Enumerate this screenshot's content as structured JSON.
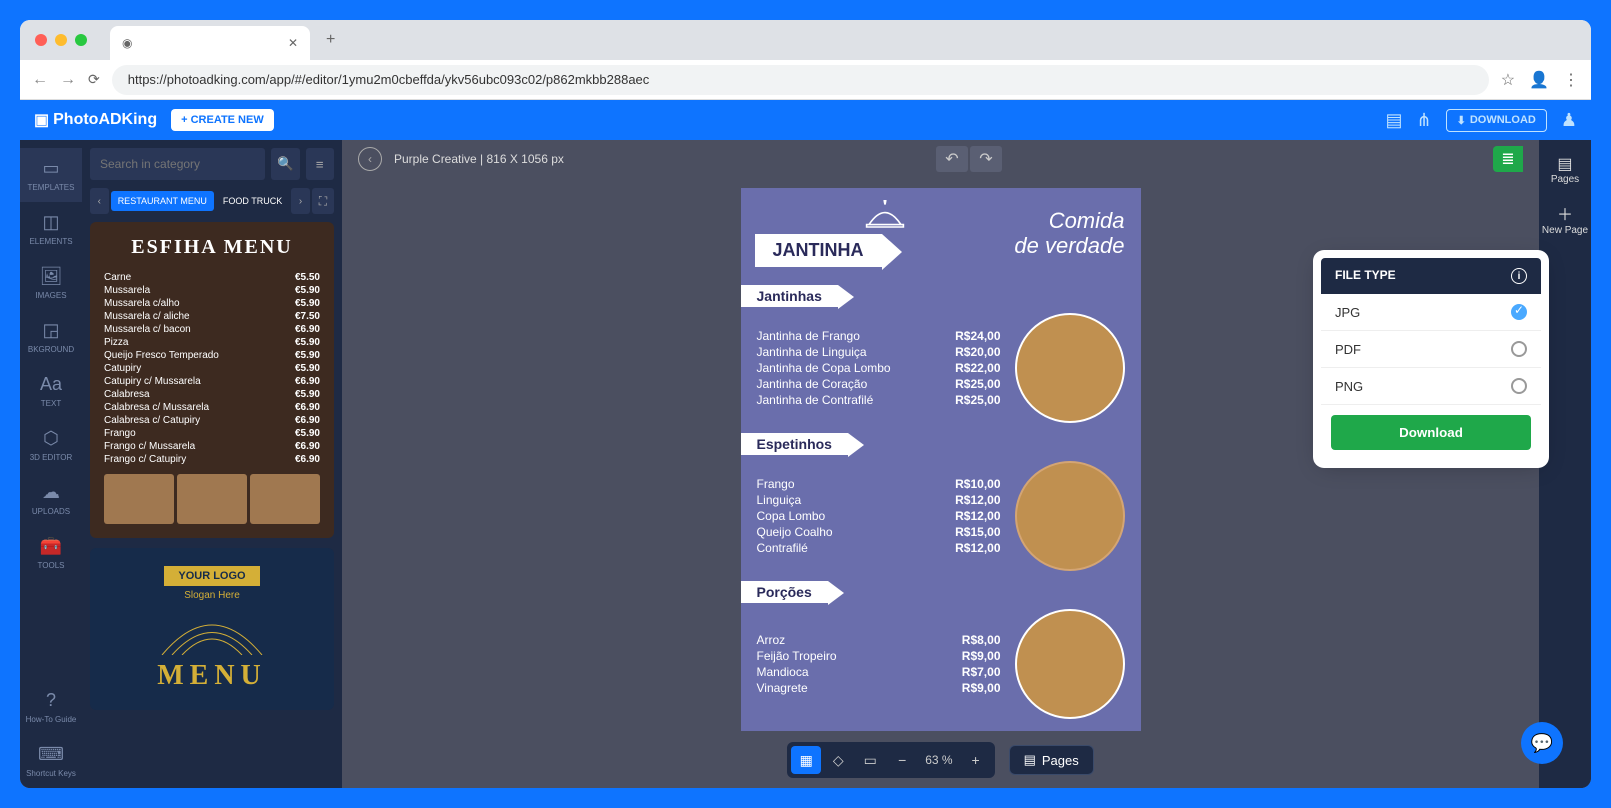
{
  "browser": {
    "url": "https://photoadking.com/app/#/editor/1ymu2m0cbeffda/ykv56ubc093c02/p862mkbb288aec"
  },
  "header": {
    "logo": "PhotoADKing",
    "create": "+ CREATE NEW",
    "download": "DOWNLOAD"
  },
  "leftIcons": {
    "templates": "TEMPLATES",
    "elements": "ELEMENTS",
    "images": "IMAGES",
    "bkground": "BKGROUND",
    "text": "TEXT",
    "threed": "3D EDITOR",
    "uploads": "UPLOADS",
    "tools": "TOOLS",
    "howto": "How-To Guide",
    "shortcuts": "Shortcut Keys"
  },
  "panel": {
    "search_ph": "Search in category",
    "cat1": "RESTAURANT MENU",
    "cat2": "FOOD TRUCK"
  },
  "tmpl1": {
    "title": "ESFIHA MENU",
    "rows": [
      {
        "n": "Carne",
        "p": "€5.50"
      },
      {
        "n": "Mussarela",
        "p": "€5.90"
      },
      {
        "n": "Mussarela c/alho",
        "p": "€5.90"
      },
      {
        "n": "Mussarela c/ aliche",
        "p": "€7.50"
      },
      {
        "n": "Mussarela c/ bacon",
        "p": "€6.90"
      },
      {
        "n": "Pizza",
        "p": "€5.90"
      },
      {
        "n": "Queijo Fresco Temperado",
        "p": "€5.90"
      },
      {
        "n": "Catupiry",
        "p": "€5.90"
      },
      {
        "n": "Catupiry c/ Mussarela",
        "p": "€6.90"
      },
      {
        "n": "Calabresa",
        "p": "€5.90"
      },
      {
        "n": "Calabresa c/ Mussarela",
        "p": "€6.90"
      },
      {
        "n": "Calabresa c/ Catupiry",
        "p": "€6.90"
      },
      {
        "n": "Frango",
        "p": "€5.90"
      },
      {
        "n": "Frango c/ Mussarela",
        "p": "€6.90"
      },
      {
        "n": "Frango c/ Catupiry",
        "p": "€6.90"
      }
    ]
  },
  "tmpl2": {
    "badge": "YOUR LOGO",
    "slogan": "Slogan Here",
    "title": "MENU"
  },
  "doc": {
    "name": "Purple Creative | 816 X 1056 px",
    "jantinha": "JANTINHA",
    "tagline1": "Comida",
    "tagline2": "de verdade",
    "sec1": "Jantinhas",
    "sec1items": [
      {
        "n": "Jantinha de Frango",
        "p": "R$24,00"
      },
      {
        "n": "Jantinha de Linguiça",
        "p": "R$20,00"
      },
      {
        "n": "Jantinha de Copa Lombo",
        "p": "R$22,00"
      },
      {
        "n": "Jantinha de Coração",
        "p": "R$25,00"
      },
      {
        "n": "Jantinha de Contrafilé",
        "p": "R$25,00"
      }
    ],
    "sec2": "Espetinhos",
    "sec2items": [
      {
        "n": "Frango",
        "p": "R$10,00"
      },
      {
        "n": "Linguiça",
        "p": "R$12,00"
      },
      {
        "n": "Copa Lombo",
        "p": "R$12,00"
      },
      {
        "n": "Queijo Coalho",
        "p": "R$15,00"
      },
      {
        "n": "Contrafilé",
        "p": "R$12,00"
      }
    ],
    "sec3": "Porções",
    "sec3items": [
      {
        "n": "Arroz",
        "p": "R$8,00"
      },
      {
        "n": "Feijão Tropeiro",
        "p": "R$9,00"
      },
      {
        "n": "Mandioca",
        "p": "R$7,00"
      },
      {
        "n": "Vinagrete",
        "p": "R$9,00"
      }
    ]
  },
  "bottom": {
    "zoom": "63 %",
    "pages": "Pages"
  },
  "right": {
    "pages": "Pages",
    "newpage": "New Page"
  },
  "popup": {
    "title": "FILE TYPE",
    "jpg": "JPG",
    "pdf": "PDF",
    "png": "PNG",
    "download": "Download"
  }
}
